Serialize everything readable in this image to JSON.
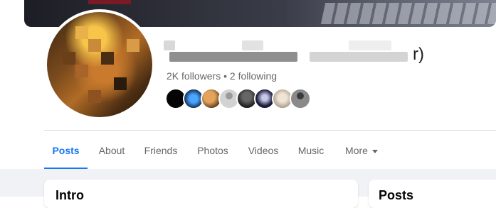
{
  "profile": {
    "name_suffix": "r)",
    "followers_text": "2K followers • 2 following"
  },
  "tabs": [
    {
      "label": "Posts"
    },
    {
      "label": "About"
    },
    {
      "label": "Friends"
    },
    {
      "label": "Photos"
    },
    {
      "label": "Videos"
    },
    {
      "label": "Music"
    },
    {
      "label": "More"
    }
  ],
  "cards": {
    "intro_title": "Intro",
    "posts_title": "Posts"
  },
  "colors": {
    "accent": "#1877f2",
    "secondary_text": "#65676b",
    "page_bg": "#f0f2f5"
  }
}
